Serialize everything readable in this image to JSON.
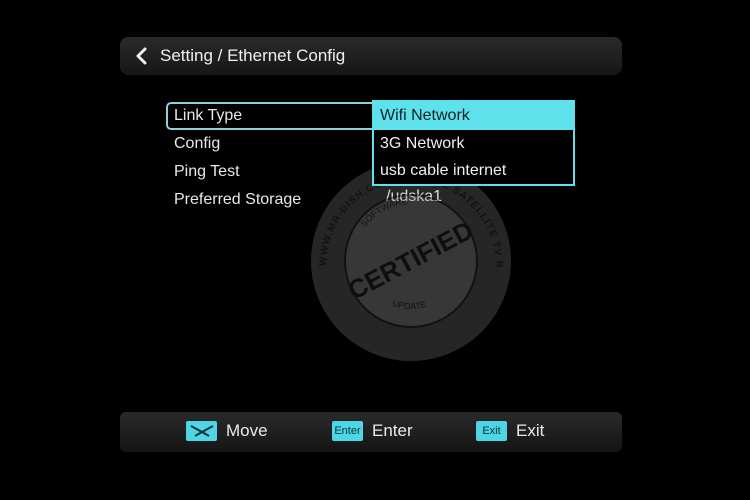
{
  "header": {
    "title": "Setting / Ethernet Config"
  },
  "menu": {
    "items": [
      {
        "label": "Link Type"
      },
      {
        "label": "Config"
      },
      {
        "label": "Ping Test"
      },
      {
        "label": "Preferred Storage"
      }
    ],
    "preferred_storage_value": "/udska1"
  },
  "dropdown": {
    "options": [
      "Wifi Network",
      "3G Network",
      "usb cable internet"
    ],
    "selected": "Wifi Network"
  },
  "footer": {
    "move": {
      "key_icon": "move-key-icon",
      "label": "Move"
    },
    "enter": {
      "key_text": "Enter",
      "label": "Enter"
    },
    "exit": {
      "key_text": "Exit",
      "label": "Exit"
    }
  },
  "watermark": {
    "certified": "CERTIFIED",
    "ring_top": "WWW.MR-DISH.COM OFFICIAL SATELLITE TV RECEIVER FILES AND SOFTWARE",
    "software": "SOFTWARE",
    "update": "UPDATE"
  },
  "colors": {
    "accent": "#5fe1ec",
    "background": "#000000",
    "bar": "#1e1e1e"
  }
}
